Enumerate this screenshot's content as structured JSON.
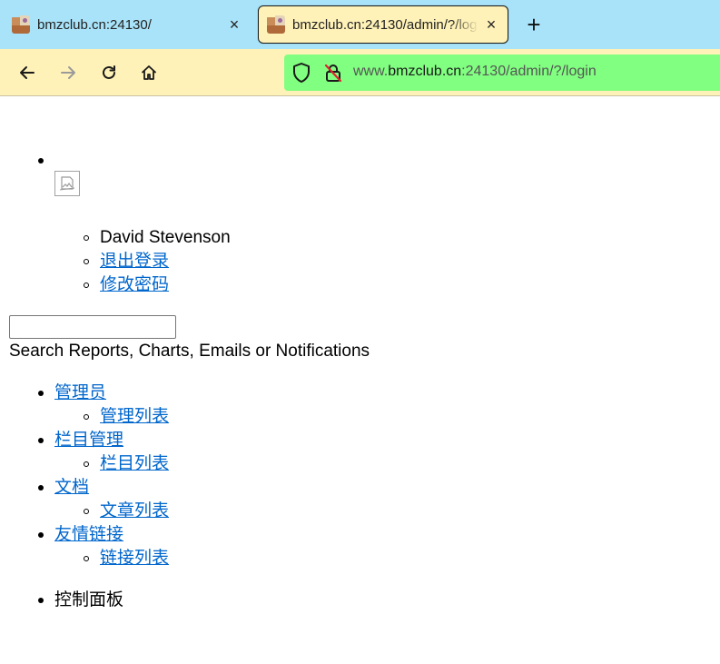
{
  "browser": {
    "tabs": [
      {
        "title": "bmzclub.cn:24130/",
        "close": "×"
      },
      {
        "title": "bmzclub.cn:24130/admin/?/login",
        "close": "×"
      }
    ],
    "new_tab": "+",
    "url": {
      "prefix": "www.",
      "host": "bmzclub.cn",
      "rest": ":24130/admin/?/login"
    },
    "colors": {
      "tab_strip": "#a9e3f9",
      "toolbar": "#fff2b8",
      "urlbar": "#80ff80"
    }
  },
  "page": {
    "user_menu": {
      "name": "David Stevenson",
      "logout": "退出登录",
      "change_password": "修改密码"
    },
    "search": {
      "value": "",
      "label": "Search Reports, Charts, Emails or Notifications"
    },
    "nav": [
      {
        "label": "管理员",
        "sub": "管理列表"
      },
      {
        "label": "栏目管理",
        "sub": "栏目列表"
      },
      {
        "label": "文档",
        "sub": "文章列表"
      },
      {
        "label": "友情链接",
        "sub": "链接列表"
      }
    ],
    "dashboard": "控制面板",
    "link_color": "#0066cc"
  }
}
